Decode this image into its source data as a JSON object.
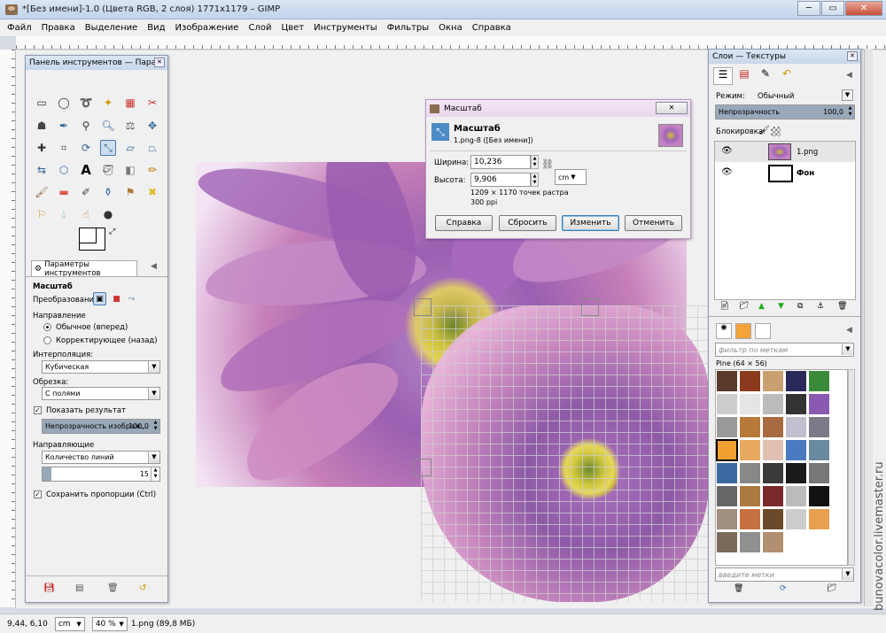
{
  "window": {
    "title": "*[Без имени]-1.0 (Цвета RGB, 2 слоя) 1771x1179 – GIMP"
  },
  "menu": [
    "Файл",
    "Правка",
    "Выделение",
    "Вид",
    "Изображение",
    "Слой",
    "Цвет",
    "Инструменты",
    "Фильтры",
    "Окна",
    "Справка"
  ],
  "toolbox": {
    "title": "Панель инструментов — Пара...",
    "tab": "Параметры инструментов",
    "tool_name": "Масштаб",
    "transform_label": "Преобразование:",
    "direction_label": "Направление",
    "direction_opts": [
      "Обычное (вперед)",
      "Корректирующее (назад)"
    ],
    "interp_label": "Интерполяция:",
    "interp_value": "Кубическая",
    "clip_label": "Обрезка:",
    "clip_value": "С полями",
    "show_result": "Показать результат",
    "opacity_label": "Непрозрачность изображ...",
    "opacity_value": "100,0",
    "opacity_fraction": 1.0,
    "guides_label": "Направляющие",
    "guides_value": "Количество линий",
    "lines_value": "15",
    "keep_ratio": "Сохранить пропорции  (Ctrl)"
  },
  "dialog": {
    "title": "Масштаб",
    "heading": "Масштаб",
    "subheading": "1.png-8 ([Без имени])",
    "width_label": "Ширина:",
    "width_value": "10,236",
    "height_label": "Высота:",
    "height_value": "9,906",
    "unit": "cm",
    "px_info": "1209 × 1170 точек растра",
    "ppi": "300 ppi",
    "btn_help": "Справка",
    "btn_reset": "Сбросить",
    "btn_apply": "Изменить",
    "btn_cancel": "Отменить"
  },
  "layers": {
    "title": "Слои — Текстуры",
    "mode_label": "Режим:",
    "mode_value": "Обычный",
    "opacity_label": "Непрозрачность",
    "opacity_value": "100,0",
    "lock_label": "Блокировка:",
    "items": [
      {
        "name": "1.png"
      },
      {
        "name": "Фон"
      }
    ],
    "filter_placeholder": "фильтр по меткам",
    "pattern_name": "Pine (64 × 56)",
    "tags_placeholder": "введите метки"
  },
  "status": {
    "coords": "9,44, 6,10",
    "unit": "cm",
    "zoom": "40 %",
    "file": "1.png (89,8 МБ)"
  },
  "watermark": "bunovacolor.livemaster.ru"
}
